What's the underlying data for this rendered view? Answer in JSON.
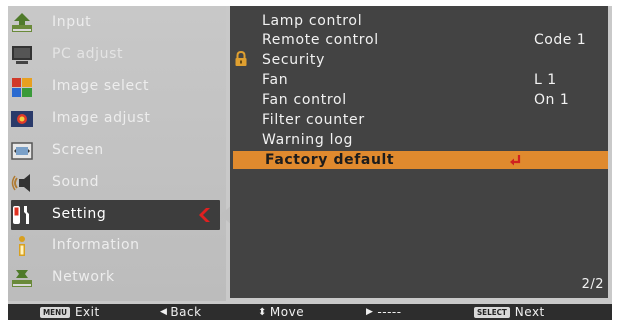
{
  "left_menu": {
    "items": [
      {
        "label": "Input",
        "icon": "input-icon"
      },
      {
        "label": "PC adjust",
        "icon": "pc-adjust-icon"
      },
      {
        "label": "Image select",
        "icon": "image-select-icon"
      },
      {
        "label": "Image adjust",
        "icon": "image-adjust-icon"
      },
      {
        "label": "Screen",
        "icon": "screen-icon"
      },
      {
        "label": "Sound",
        "icon": "sound-icon"
      },
      {
        "label": "Setting",
        "icon": "setting-icon"
      },
      {
        "label": "Information",
        "icon": "information-icon"
      },
      {
        "label": "Network",
        "icon": "network-icon"
      }
    ],
    "active_index": 6
  },
  "right_menu": {
    "items": [
      {
        "label": "Lamp control",
        "value": ""
      },
      {
        "label": "Remote control",
        "value": "Code 1"
      },
      {
        "label": "Security",
        "value": "",
        "icon": "lock-icon"
      },
      {
        "label": "Fan",
        "value": "L 1"
      },
      {
        "label": "Fan control",
        "value": "On 1"
      },
      {
        "label": "Filter counter",
        "value": ""
      },
      {
        "label": "Warning log",
        "value": ""
      },
      {
        "label": "Factory default",
        "value": "",
        "icon": "enter-icon"
      }
    ],
    "highlight_index": 7,
    "page_indicator": "2/2"
  },
  "status_bar": {
    "exit_key": "MENU",
    "exit_label": "Exit",
    "back_label": "Back",
    "move_label": "Move",
    "forward_label": "-----",
    "next_key": "SELECT",
    "next_label": "Next"
  },
  "colors": {
    "left_bg": "#c2c2c2",
    "right_bg": "#434343",
    "highlight": "#e08a2e",
    "active_arrow": "#e02020",
    "statusbar_bg": "#2d2d2d"
  }
}
